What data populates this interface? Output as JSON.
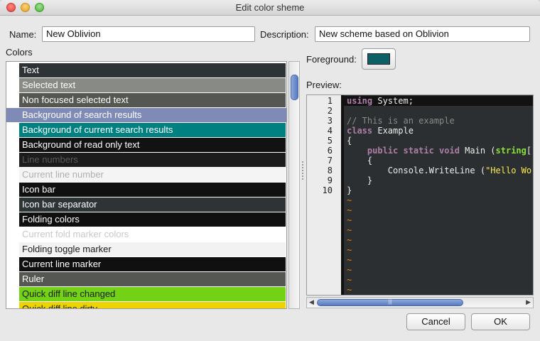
{
  "window": {
    "title": "Edit color sheme"
  },
  "form": {
    "name_label": "Name:",
    "name_value": "New Oblivion",
    "description_label": "Description:",
    "description_value": "New scheme based on Oblivion"
  },
  "colors": {
    "label": "Colors",
    "items": [
      {
        "label": "Text",
        "bg": "#2e3436",
        "fg": "#ffffff"
      },
      {
        "label": "Selected text",
        "bg": "#888a85",
        "fg": "#ffffff"
      },
      {
        "label": "Non focused selected text",
        "bg": "#555753",
        "fg": "#ffffff"
      },
      {
        "label": "Background of search results",
        "bg": "#7f8bb6",
        "fg": "#ffffff"
      },
      {
        "label": "Background of current search results",
        "bg": "#008080",
        "fg": "#ffffff"
      },
      {
        "label": "Background of read only text",
        "bg": "#121212",
        "fg": "#ffffff"
      },
      {
        "label": "Line numbers",
        "bg": "#1c1c1c",
        "fg": "#5a5a5a"
      },
      {
        "label": "Current line number",
        "bg": "#f4f4f4",
        "fg": "#b0b0b0"
      },
      {
        "label": "Icon bar",
        "bg": "#101010",
        "fg": "#ffffff"
      },
      {
        "label": "Icon bar separator",
        "bg": "#2e3436",
        "fg": "#ffffff"
      },
      {
        "label": "Folding colors",
        "bg": "#101010",
        "fg": "#ffffff"
      },
      {
        "label": "Current fold marker colors",
        "bg": "#ffffff",
        "fg": "#c8c8c8"
      },
      {
        "label": "Folding toggle marker",
        "bg": "#f2f2f2",
        "fg": "#1a1a1a"
      },
      {
        "label": "Current line marker",
        "bg": "#101010",
        "fg": "#ffffff"
      },
      {
        "label": "Ruler",
        "bg": "#555753",
        "fg": "#ffffff"
      },
      {
        "label": "Quick diff line changed",
        "bg": "#73d216",
        "fg": "#1a1a1a"
      },
      {
        "label": "Quick diff line dirty",
        "bg": "#edd400",
        "fg": "#1a1a1a"
      }
    ]
  },
  "foreground": {
    "label": "Foreground:",
    "color": "#0b5f65"
  },
  "preview": {
    "label": "Preview:",
    "line_numbers": [
      "1",
      "2",
      "3",
      "4",
      "5",
      "6",
      "7",
      "8",
      "9",
      "10"
    ],
    "code": {
      "l1_kw": "using",
      "l1_rest": " System;",
      "l3_comment": "// This is an example",
      "l4_kw": "class",
      "l4_rest": " Example",
      "l5": "{",
      "l6_indent": "    ",
      "l6_kw": "public static void",
      "l6_rest": " Main (",
      "l6_type": "string",
      "l6_tail": "[]",
      "l7": "    {",
      "l8_code": "        Console.WriteLine (",
      "l8_str": "\"Hello World\"",
      "l9": "    }",
      "l10": "}"
    },
    "tilde": "~"
  },
  "scrollbar": {
    "grip": "|||"
  },
  "buttons": {
    "cancel": "Cancel",
    "ok": "OK"
  }
}
